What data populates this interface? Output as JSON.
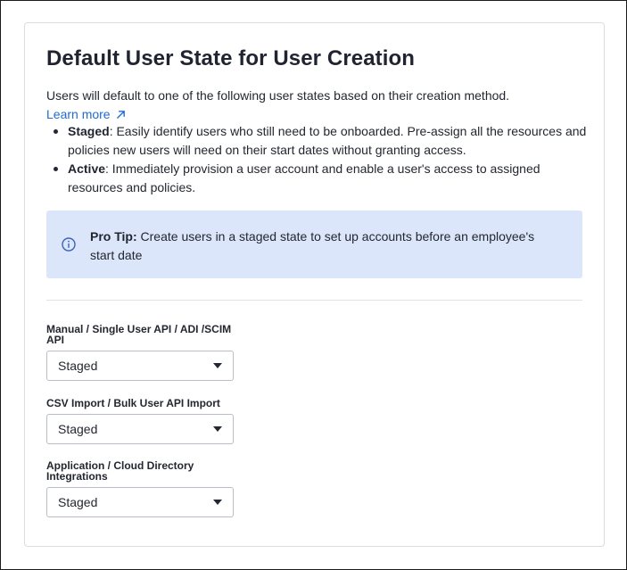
{
  "card": {
    "title": "Default User State for User Creation",
    "description": "Users will default to one of the following user states based on their creation method.",
    "learn_more": "Learn more",
    "bullets": [
      {
        "term": "Staged",
        "text": ": Easily identify users who still need to be onboarded. Pre-assign all the resources and policies new users will need on their start dates without granting access."
      },
      {
        "term": "Active",
        "text": ": Immediately provision a user account and enable a user's access to assigned resources and policies."
      }
    ],
    "tip": {
      "label": "Pro Tip:",
      "text": " Create users in a staged state to set up accounts before an employee's start date"
    }
  },
  "fields": [
    {
      "label": "Manual / Single User API / ADI /SCIM API",
      "value": "Staged"
    },
    {
      "label": "CSV Import / Bulk User API Import",
      "value": "Staged"
    },
    {
      "label": "Application / Cloud Directory Integrations",
      "value": "Staged"
    }
  ],
  "colors": {
    "link": "#1f6bd0",
    "tip_background": "#dbe6fb",
    "info_icon": "#3a63b8"
  },
  "icons": {
    "learn_more": "external-link-arrow-icon",
    "tip": "info-icon",
    "dropdown": "caret-down-icon"
  }
}
